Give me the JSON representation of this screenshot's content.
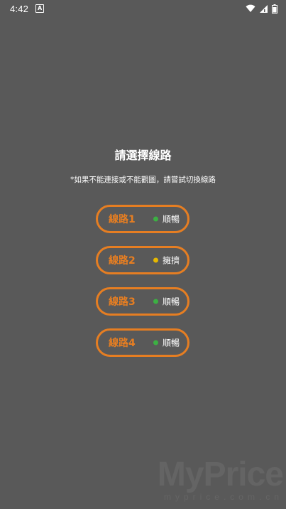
{
  "status_bar": {
    "time": "4:42",
    "notification_glyph": "A",
    "icons": [
      "wifi-icon",
      "signal-icon",
      "battery-icon"
    ]
  },
  "title": "請選擇線路",
  "subtitle": "*如果不能連接或不能觀圖，請嘗試切換線路",
  "routes": [
    {
      "label": "線路1",
      "status": "順暢",
      "status_color": "#3cb043"
    },
    {
      "label": "線路2",
      "status": "擁擠",
      "status_color": "#e6b800"
    },
    {
      "label": "線路3",
      "status": "順暢",
      "status_color": "#3cb043"
    },
    {
      "label": "線路4",
      "status": "順暢",
      "status_color": "#3cb043"
    }
  ],
  "accent_color": "#e67e22",
  "watermark": {
    "big": "MyPrice",
    "small": "myprice.com.cn"
  }
}
